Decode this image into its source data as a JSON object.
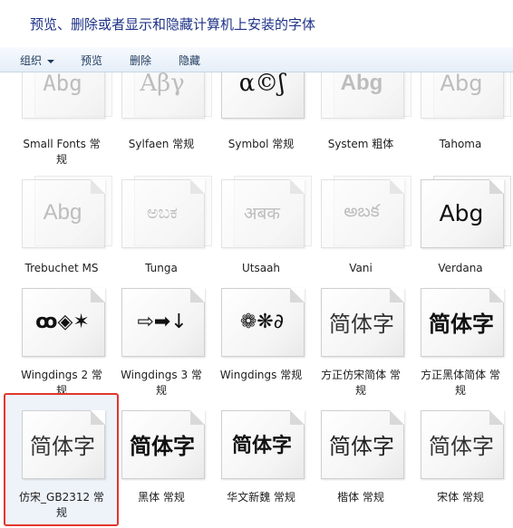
{
  "header": {
    "title": "预览、删除或者显示和隐藏计算机上安装的字体"
  },
  "toolbar": {
    "organize": "组织",
    "preview": "预览",
    "delete": "删除",
    "hide": "隐藏"
  },
  "fonts": [
    {
      "name": "Small Fonts 常规",
      "line1": "Small Fonts 常",
      "line2": "规",
      "sample": "Abg",
      "hidden": true
    },
    {
      "name": "Sylfaen 常规",
      "line1": "Sylfaen 常规",
      "sample": "Αβγ",
      "hidden": true
    },
    {
      "name": "Symbol 常规",
      "line1": "Symbol 常规",
      "sample": "α©ʃ",
      "hidden": false
    },
    {
      "name": "System 粗体",
      "line1": "System 粗体",
      "sample": "Abg",
      "hidden": true
    },
    {
      "name": "Tahoma",
      "line1": "Tahoma",
      "sample": "Abg",
      "hidden": true
    },
    {
      "name": "Trebuchet MS",
      "line1": "Trebuchet MS",
      "sample": "Abg",
      "hidden": true
    },
    {
      "name": "Tunga",
      "line1": "Tunga",
      "sample": "ಅಬಕ",
      "hidden": true
    },
    {
      "name": "Utsaah",
      "line1": "Utsaah",
      "sample": "अबक",
      "hidden": true
    },
    {
      "name": "Vani",
      "line1": "Vani",
      "sample": "అబక",
      "hidden": true
    },
    {
      "name": "Verdana",
      "line1": "Verdana",
      "sample": "Abg",
      "hidden": false
    },
    {
      "name": "Wingdings 2 常规",
      "line1": "Wingdings 2 常",
      "line2": "规",
      "sample": "ꝏ◈✶",
      "hidden": false
    },
    {
      "name": "Wingdings 3 常规",
      "line1": "Wingdings 3 常",
      "line2": "规",
      "sample": "⇨➡↓",
      "hidden": false
    },
    {
      "name": "Wingdings 常规",
      "line1": "Wingdings 常规",
      "sample": "❁❋∂",
      "hidden": false
    },
    {
      "name": "方正仿宋简体 常规",
      "line1": "方正仿宋简体 常",
      "line2": "规",
      "sample": "简体字",
      "hidden": false
    },
    {
      "name": "方正黑体简体 常规",
      "line1": "方正黑体简体 常",
      "line2": "规",
      "sample": "简体字",
      "hidden": false
    },
    {
      "name": "仿宋_GB2312 常规",
      "line1": "仿宋_GB2312 常",
      "line2": "规",
      "sample": "简体字",
      "hidden": false
    },
    {
      "name": "黑体 常规",
      "line1": "黑体 常规",
      "sample": "简体字",
      "hidden": false
    },
    {
      "name": "华文新魏 常规",
      "line1": "华文新魏 常规",
      "sample": "简体字",
      "hidden": false
    },
    {
      "name": "楷体 常规",
      "line1": "楷体 常规",
      "sample": "简体字",
      "hidden": false
    },
    {
      "name": "宋体 常规",
      "line1": "宋体 常规",
      "sample": "简体字",
      "hidden": false
    }
  ]
}
